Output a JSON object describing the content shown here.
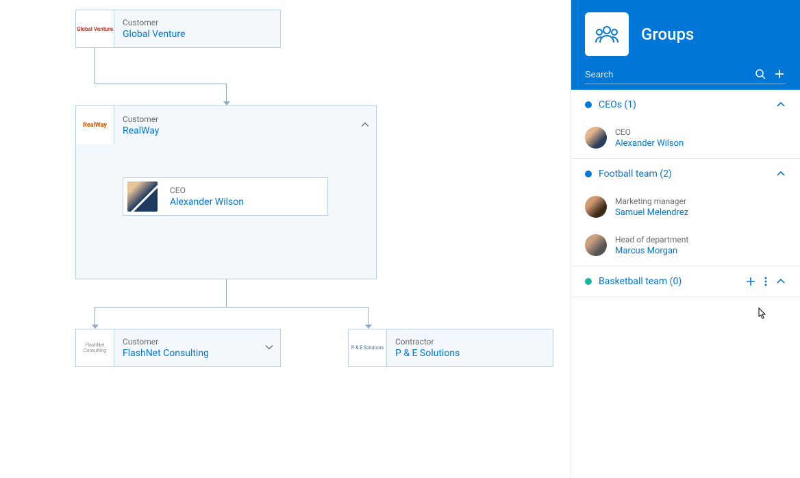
{
  "sidebar": {
    "title": "Groups",
    "search_placeholder": "Search"
  },
  "groups": [
    {
      "label": "CEOs (1)",
      "dot_color": "#0076d6",
      "expanded": true,
      "show_actions": false,
      "members": [
        {
          "role": "CEO",
          "name": "Alexander Wilson",
          "avatar_class": "av-1"
        }
      ]
    },
    {
      "label": "Football team (2)",
      "dot_color": "#0076d6",
      "expanded": true,
      "show_actions": false,
      "members": [
        {
          "role": "Marketing manager",
          "name": "Samuel Melendrez",
          "avatar_class": "av-2"
        },
        {
          "role": "Head of department",
          "name": "Marcus Morgan",
          "avatar_class": "av-3"
        }
      ]
    },
    {
      "label": "Basketball team (0)",
      "dot_color": "#17b39b",
      "expanded": true,
      "show_actions": true,
      "members": []
    }
  ],
  "canvas": {
    "global_venture": {
      "type": "Customer",
      "title": "Global Venture",
      "logo_text": "Global Venture"
    },
    "realway": {
      "type": "Customer",
      "title": "RealWay",
      "logo_text": "RealWay"
    },
    "ceo": {
      "role": "CEO",
      "name": "Alexander Wilson"
    },
    "flashnet": {
      "type": "Customer",
      "title": "FlashNet Consulting",
      "logo_text": "FlashNet Consulting"
    },
    "pe": {
      "type": "Contractor",
      "title": "P & E Solutions",
      "logo_text": "P & E Solutions"
    }
  },
  "colors": {
    "primary": "#0076d6",
    "node_border": "#b8cfe6",
    "node_bg": "#f3f8fd",
    "connector": "#8fa8c4"
  }
}
